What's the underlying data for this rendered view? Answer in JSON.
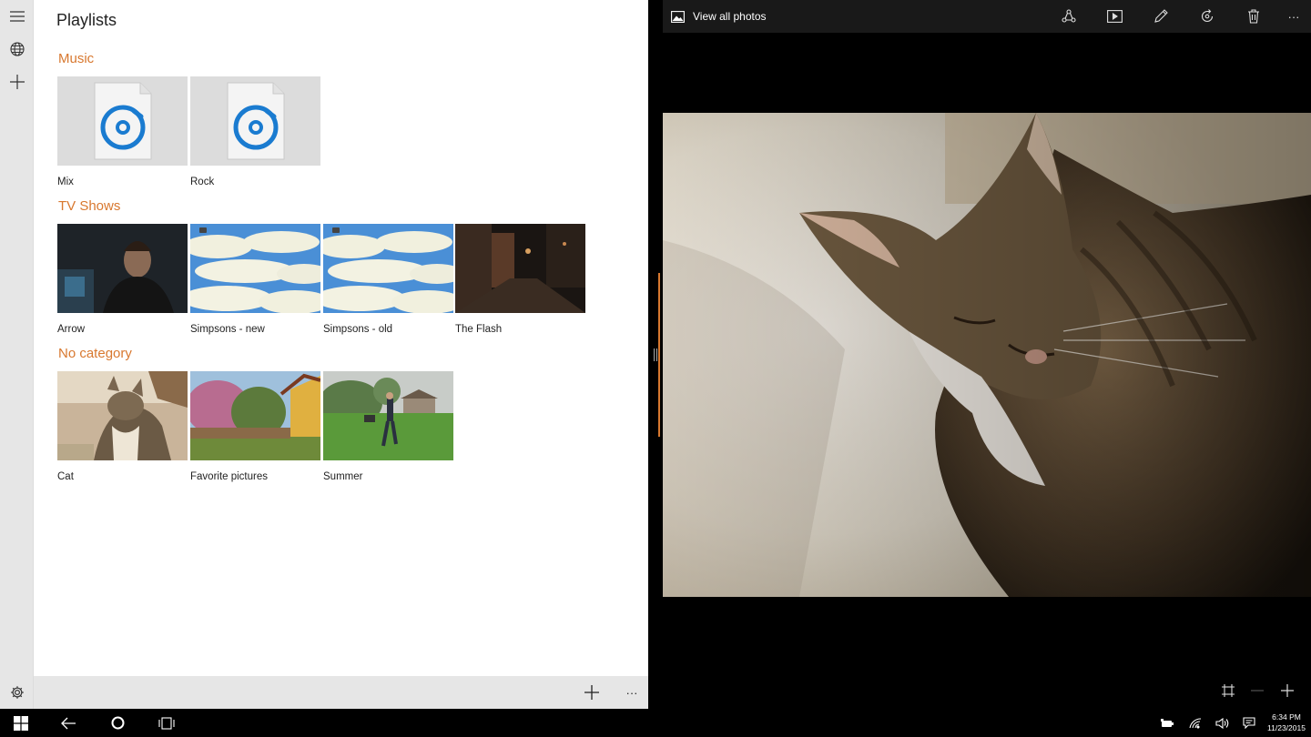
{
  "left_app": {
    "title": "Playlists",
    "sections": [
      {
        "name": "Music",
        "items": [
          {
            "label": "Mix",
            "thumb": "music-file-icon"
          },
          {
            "label": "Rock",
            "thumb": "music-file-icon"
          }
        ]
      },
      {
        "name": "TV Shows",
        "items": [
          {
            "label": "Arrow",
            "thumb": "dark-portrait"
          },
          {
            "label": "Simpsons - new",
            "thumb": "cloud-sky"
          },
          {
            "label": "Simpsons - old",
            "thumb": "cloud-sky"
          },
          {
            "label": "The Flash",
            "thumb": "night-street"
          }
        ]
      },
      {
        "name": "No category",
        "items": [
          {
            "label": "Cat",
            "thumb": "cat-photo"
          },
          {
            "label": "Favorite pictures",
            "thumb": "garden-photo"
          },
          {
            "label": "Summer",
            "thumb": "lawn-photo"
          }
        ]
      }
    ],
    "nav_icons": [
      "hamburger-menu-icon",
      "globe-icon",
      "plus-icon",
      "gear-icon"
    ],
    "command_bar": {
      "add_icon": "plus-icon",
      "more": "···"
    }
  },
  "right_app": {
    "toolbar": {
      "view_all_label": "View all photos",
      "more": "···",
      "icons": [
        "share-icon",
        "slideshow-icon",
        "edit-pencil-icon",
        "rotate-icon",
        "delete-icon"
      ]
    },
    "zoom_icons": [
      "fit-to-window-icon",
      "zoom-out-icon",
      "zoom-in-icon"
    ]
  },
  "taskbar": {
    "time": "6:34 PM",
    "date": "11/23/2015",
    "icons": [
      "windows-start-icon",
      "back-icon",
      "cortana-icon",
      "task-view-icon",
      "battery-icon",
      "wifi-icon",
      "volume-icon",
      "action-center-icon"
    ]
  },
  "colors": {
    "accent": "#d8782f",
    "music_icon": "#1a7bd0",
    "taskbar": "#000000",
    "rail": "#e6e6e6"
  }
}
